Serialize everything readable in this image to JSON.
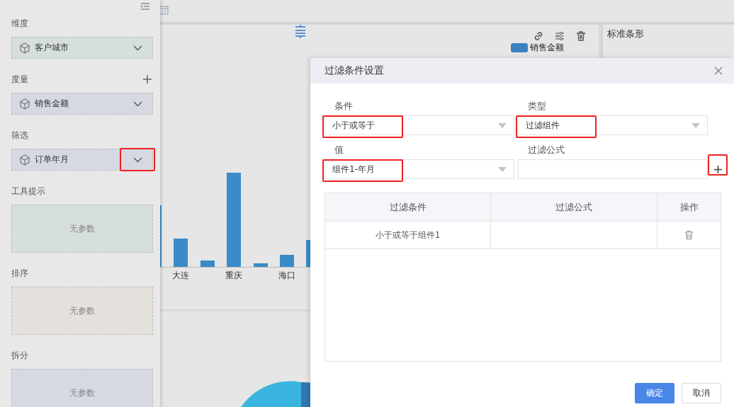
{
  "sidebar": {
    "sections": [
      {
        "title": "维度",
        "kind": "field",
        "field": "客户城市",
        "color": "#d6dfdc",
        "highlighted": false,
        "addable": false
      },
      {
        "title": "度量",
        "kind": "field",
        "field": "销售金额",
        "color": "#d6d9e2",
        "highlighted": false,
        "addable": true
      },
      {
        "title": "筛选",
        "kind": "field",
        "field": "订单年月",
        "color": "#d6d9e2",
        "highlighted": true,
        "addable": false
      },
      {
        "title": "工具提示",
        "kind": "empty",
        "placeholder": "无参数",
        "color": "#d6dfdc",
        "addable": false
      },
      {
        "title": "排序",
        "kind": "empty",
        "placeholder": "无参数",
        "color": "#e4e0dc",
        "addable": false
      },
      {
        "title": "拆分",
        "kind": "empty",
        "placeholder": "无参数",
        "color": "#d6d9e2",
        "addable": false
      }
    ]
  },
  "chart": {
    "legend": "销售金额",
    "x_labels": [
      "大连",
      "重庆",
      "海口"
    ]
  },
  "side_panel": {
    "title": "标准条形"
  },
  "dialog": {
    "title": "过滤条件设置",
    "fields": [
      {
        "label": "条件",
        "kind": "select",
        "value": "小于或等于",
        "highlighted": true
      },
      {
        "label": "类型",
        "kind": "select",
        "value": "过滤组件",
        "highlighted": true
      },
      {
        "label": "值",
        "kind": "select",
        "value": "组件1-年月",
        "highlighted": true
      },
      {
        "label": "过滤公式",
        "kind": "input",
        "highlighted": false
      }
    ],
    "add_highlighted": true,
    "table": {
      "columns": [
        "过滤条件",
        "过滤公式",
        "操作"
      ],
      "rows": [
        {
          "cells": [
            "小于或等于组件1"
          ]
        }
      ]
    },
    "buttons": [
      {
        "label": "确定",
        "kind": "primary"
      },
      {
        "label": "取消",
        "kind": "default"
      }
    ]
  }
}
